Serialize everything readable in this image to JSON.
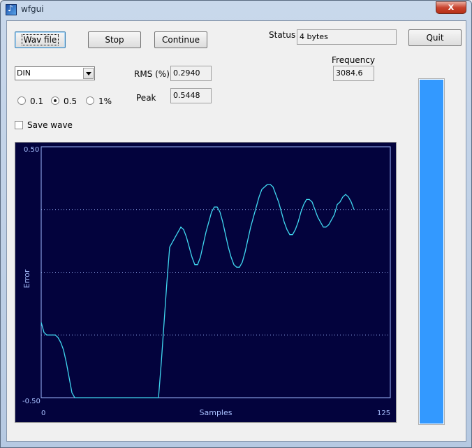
{
  "window": {
    "title": "wfgui",
    "close_symbol": "x"
  },
  "toolbar": {
    "wav_file_label": "Wav file",
    "stop_label": "Stop",
    "continue_label": "Continue",
    "quit_label": "Quit"
  },
  "status": {
    "label": "Status",
    "value": "4 bytes"
  },
  "frequency": {
    "label": "Frequency",
    "value": "3084.6"
  },
  "weighting": {
    "selected": "DIN"
  },
  "rms": {
    "label": "RMS (%)",
    "value": "0.2940"
  },
  "peak": {
    "label": "Peak",
    "value": "0.5448"
  },
  "range_options": [
    {
      "label": "0.1",
      "checked": false
    },
    {
      "label": "0.5",
      "checked": true
    },
    {
      "label": "1%",
      "checked": false
    }
  ],
  "save_wave": {
    "label": "Save wave",
    "checked": false
  },
  "level_meter": {
    "fraction": 1.0,
    "color": "#3399ff"
  },
  "chart_data": {
    "type": "line",
    "xlabel": "Samples",
    "ylabel": "Error",
    "xlim": [
      0,
      125
    ],
    "ylim": [
      -0.5,
      0.5
    ],
    "y_tick_labels": [
      "0.50",
      "-0.50"
    ],
    "x_tick_labels": [
      "0",
      "125"
    ],
    "grid": "dotted horizontal at -0.25, 0, 0.25",
    "background": "#03033d",
    "line_color": "#40d8f0",
    "x": [
      0,
      1,
      2,
      3,
      4,
      5,
      6,
      7,
      8,
      9,
      10,
      11,
      12,
      13,
      14,
      15,
      16,
      17,
      18,
      19,
      20,
      21,
      22,
      23,
      24,
      25,
      26,
      27,
      28,
      29,
      30,
      31,
      32,
      33,
      34,
      35,
      36,
      37,
      38,
      39,
      40,
      41,
      42,
      43,
      44,
      45,
      46,
      47,
      48,
      49,
      50,
      51,
      52,
      53,
      54,
      55,
      56,
      57,
      58,
      59,
      60,
      61,
      62,
      63,
      64,
      65,
      66,
      67,
      68,
      69,
      70,
      71,
      72,
      73,
      74,
      75,
      76,
      77,
      78,
      79,
      80,
      81,
      82,
      83,
      84,
      85,
      86,
      87,
      88,
      89,
      90,
      91,
      92,
      93,
      94,
      95,
      96,
      97,
      98,
      99,
      100,
      101,
      102,
      103,
      104,
      105,
      106,
      107,
      108,
      109,
      110,
      111,
      112,
      113,
      114,
      115,
      116,
      117,
      118,
      119,
      120,
      121,
      122,
      123,
      124,
      125
    ],
    "values": [
      -0.2,
      -0.24,
      -0.25,
      -0.25,
      -0.25,
      -0.25,
      -0.26,
      -0.28,
      -0.31,
      -0.36,
      -0.42,
      -0.48,
      -0.5,
      -0.5,
      -0.5,
      -0.5,
      -0.5,
      -0.5,
      -0.5,
      -0.5,
      -0.5,
      -0.5,
      -0.5,
      -0.5,
      -0.5,
      -0.5,
      -0.5,
      -0.5,
      -0.5,
      -0.5,
      -0.5,
      -0.5,
      -0.5,
      -0.5,
      -0.5,
      -0.5,
      -0.5,
      -0.5,
      -0.5,
      -0.5,
      -0.5,
      -0.5,
      -0.5,
      -0.36,
      -0.2,
      -0.04,
      0.1,
      0.12,
      0.14,
      0.16,
      0.18,
      0.17,
      0.14,
      0.1,
      0.06,
      0.03,
      0.03,
      0.06,
      0.11,
      0.16,
      0.2,
      0.24,
      0.26,
      0.26,
      0.24,
      0.2,
      0.15,
      0.1,
      0.06,
      0.03,
      0.02,
      0.02,
      0.04,
      0.08,
      0.13,
      0.18,
      0.22,
      0.26,
      0.3,
      0.33,
      0.34,
      0.35,
      0.35,
      0.34,
      0.31,
      0.28,
      0.24,
      0.2,
      0.17,
      0.15,
      0.15,
      0.17,
      0.2,
      0.24,
      0.27,
      0.29,
      0.29,
      0.28,
      0.25,
      0.22,
      0.2,
      0.18,
      0.18,
      0.19,
      0.21,
      0.23,
      0.27,
      0.28,
      0.3,
      0.31,
      0.3,
      0.28,
      0.25
    ]
  }
}
